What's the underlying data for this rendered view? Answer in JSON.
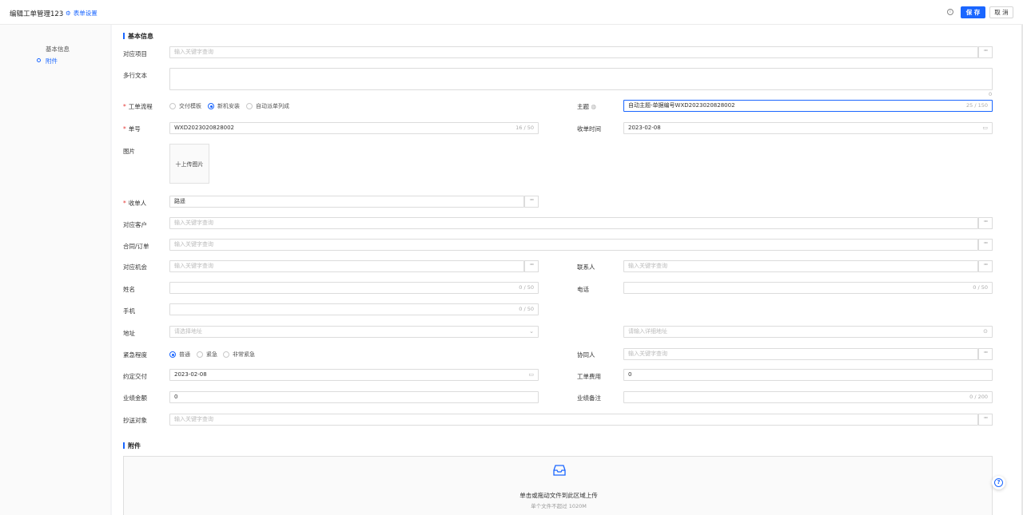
{
  "header": {
    "title": "编辑工单管理123",
    "form_settings": "表单设置",
    "save": "保 存",
    "cancel": "取 消"
  },
  "sidebar": {
    "items": [
      {
        "label": "基本信息"
      },
      {
        "label": "附件"
      }
    ]
  },
  "sections": {
    "basic": "基本信息",
    "attachment": "附件"
  },
  "fields": {
    "project": {
      "label": "对应项目",
      "placeholder": "输入关键字查询"
    },
    "multiline": {
      "label": "多行文本",
      "count": "0"
    },
    "workflow": {
      "label": "工单流程",
      "options": [
        "交付模板",
        "新机安装",
        "自动派单列成"
      ],
      "selected": "新机安装"
    },
    "subject": {
      "label": "主题",
      "value": "自动主题-单据编号WXD2023020828002",
      "count": "25 / 150"
    },
    "number": {
      "label": "单号",
      "value": "WXD2023020828002",
      "count": "16 / 50"
    },
    "receive_time": {
      "label": "收单时间",
      "value": "2023-02-08"
    },
    "image": {
      "label": "图片",
      "upload": "十上传图片"
    },
    "receiver": {
      "label": "收单人",
      "value": "路遥"
    },
    "customer": {
      "label": "对应客户",
      "placeholder": "输入关键字查询"
    },
    "contract": {
      "label": "合同/订单",
      "placeholder": "输入关键字查询"
    },
    "opportunity": {
      "label": "对应机会",
      "placeholder": "输入关键字查询"
    },
    "contact": {
      "label": "联系人",
      "placeholder": "输入关键字查询"
    },
    "name": {
      "label": "姓名",
      "count": "0 / 50"
    },
    "phone": {
      "label": "电话",
      "count": "0 / 50"
    },
    "mobile": {
      "label": "手机",
      "count": "0 / 50"
    },
    "address": {
      "label": "地址",
      "placeholder": "请选择地址",
      "detail_placeholder": "请输入详细地址"
    },
    "urgency": {
      "label": "紧急程度",
      "options": [
        "普通",
        "紧急",
        "非常紧急"
      ],
      "selected": "普通"
    },
    "collaborator": {
      "label": "协同人",
      "placeholder": "输入关键字查询"
    },
    "delivery_date": {
      "label": "约定交付",
      "value": "2023-02-08"
    },
    "fee": {
      "label": "工单费用",
      "value": "0"
    },
    "amount": {
      "label": "业绩金额",
      "value": "0"
    },
    "remark": {
      "label": "业绩备注",
      "count": "0 / 200"
    },
    "cc": {
      "label": "抄送对象",
      "placeholder": "输入关键字查询"
    }
  },
  "upload": {
    "main": "单击或拖动文件到此区域上传",
    "sub": "单个文件不超过 1020M"
  },
  "icons": {
    "more": "···",
    "help": "?",
    "info": "i"
  },
  "colors": {
    "primary": "#1a66ff",
    "required": "#e53935"
  }
}
